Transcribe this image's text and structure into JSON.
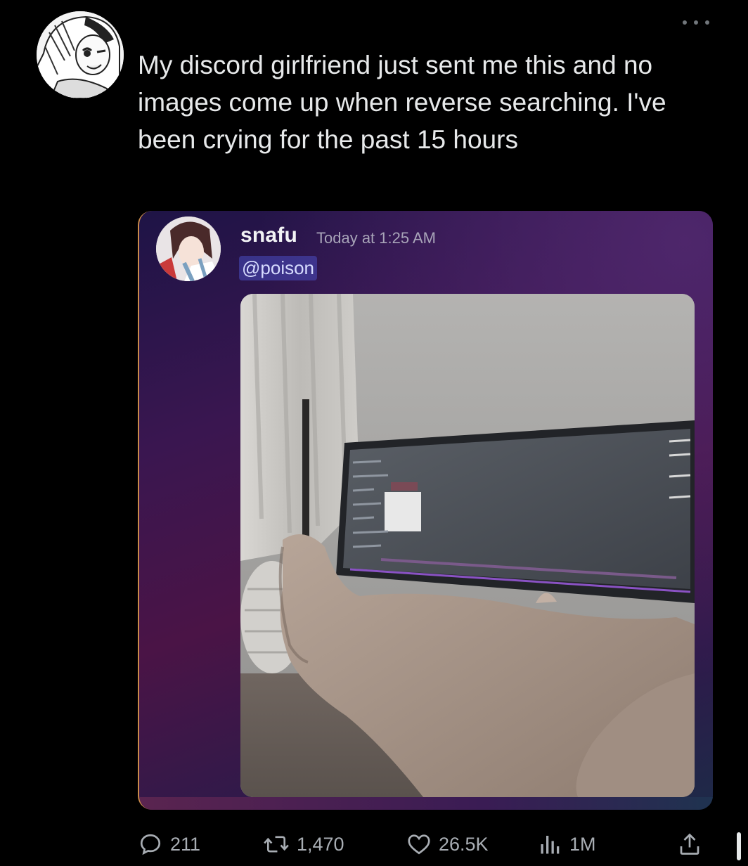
{
  "tweet": {
    "text": "My discord girlfriend just sent me this and no images come up when reverse searching. I've been crying for the past 15 hours"
  },
  "discord_message": {
    "username": "snafu",
    "timestamp": "Today at 1:25 AM",
    "mention": "@poison"
  },
  "actions": {
    "replies": "211",
    "retweets": "1,470",
    "likes": "26.5K",
    "views": "1M"
  },
  "icons": {
    "more": "more-icon",
    "reply": "reply-icon",
    "retweet": "retweet-icon",
    "like": "heart-icon",
    "views": "views-icon",
    "share": "share-icon"
  },
  "colors": {
    "background": "#000000",
    "text": "#e7e9ea",
    "muted": "#a8adb3",
    "mention_bg": "#5865f2"
  }
}
